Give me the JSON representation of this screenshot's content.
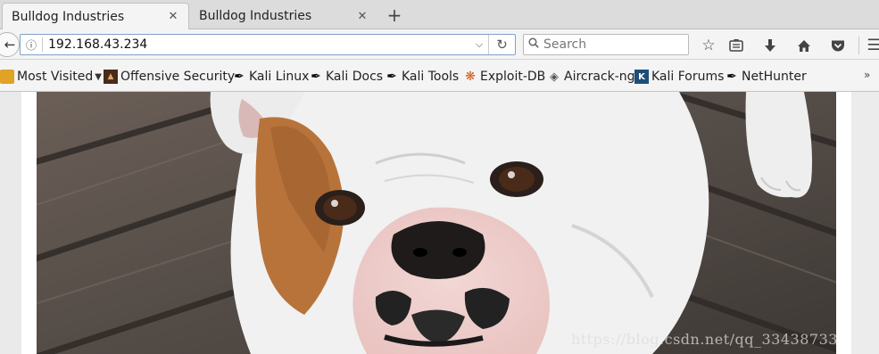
{
  "tabs": [
    {
      "title": "Bulldog Industries",
      "close": "✕"
    },
    {
      "title": "Bulldog Industries",
      "close": "✕"
    }
  ],
  "new_tab_label": "+",
  "navbar": {
    "url": "192.168.43.234",
    "search_placeholder": "Search",
    "icons": [
      "back-arrow-icon",
      "info-icon",
      "dropdown-icon",
      "reload-icon",
      "search-icon",
      "bookmark-star-icon",
      "reading-list-icon",
      "download-icon",
      "home-icon",
      "pocket-icon",
      "hamburger-menu-icon"
    ]
  },
  "bookmarks": [
    {
      "label": "Most Visited",
      "icon": "folder-icon"
    },
    {
      "label": "Offensive Security",
      "icon": "offsec-icon"
    },
    {
      "label": "Kali Linux",
      "icon": "kali-dragon-icon"
    },
    {
      "label": "Kali Docs",
      "icon": "kali-dragon-icon"
    },
    {
      "label": "Kali Tools",
      "icon": "kali-dragon-icon"
    },
    {
      "label": "Exploit-DB",
      "icon": "exploit-db-icon"
    },
    {
      "label": "Aircrack-ng",
      "icon": "aircrack-icon"
    },
    {
      "label": "Kali Forums",
      "icon": "kali-forums-icon"
    },
    {
      "label": "NetHunter",
      "icon": "kali-dragon-icon"
    }
  ],
  "content": {
    "image_subject": "bulldog-photo",
    "watermark": "https://blog.csdn.net/qq_33438733"
  },
  "colors": {
    "url_border": "#7ea1c8",
    "wood_dark": "#4a4440",
    "dog_white": "#f2f2f2",
    "dog_tan": "#b8733a"
  }
}
